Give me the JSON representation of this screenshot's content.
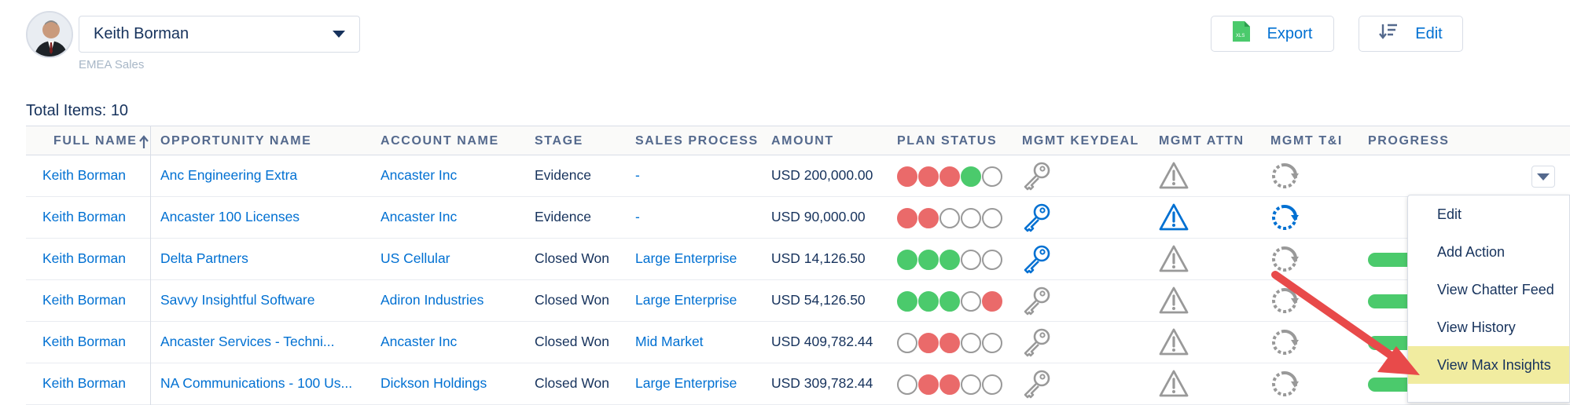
{
  "header": {
    "user_name": "Keith Borman",
    "user_subtitle": "EMEA Sales",
    "export_label": "Export",
    "edit_label": "Edit",
    "export_icon_text": "XLS"
  },
  "total_items": "Total Items: 10",
  "columns": [
    "FULL NAME",
    "OPPORTUNITY NAME",
    "ACCOUNT NAME",
    "STAGE",
    "SALES PROCESS",
    "AMOUNT",
    "PLAN STATUS",
    "MGMT KEYDEAL",
    "MGMT ATTN",
    "MGMT T&I",
    "PROGRESS"
  ],
  "rows": [
    {
      "full_name": "Keith Borman",
      "opportunity": "Anc Engineering Extra",
      "account": "Ancaster Inc",
      "stage": "Evidence",
      "sales_process": "-",
      "amount": "USD 200,000.00",
      "plan_status": [
        "red",
        "red",
        "red",
        "green",
        "empty"
      ],
      "keydeal_active": false,
      "attn_active": false,
      "ti_active": false,
      "progress": false
    },
    {
      "full_name": "Keith Borman",
      "opportunity": "Ancaster 100 Licenses",
      "account": "Ancaster Inc",
      "stage": "Evidence",
      "sales_process": "-",
      "amount": "USD 90,000.00",
      "plan_status": [
        "red",
        "red",
        "empty",
        "empty",
        "empty"
      ],
      "keydeal_active": true,
      "attn_active": true,
      "ti_active": true,
      "progress": false
    },
    {
      "full_name": "Keith Borman",
      "opportunity": "Delta Partners",
      "account": "US Cellular",
      "stage": "Closed Won",
      "sales_process": "Large Enterprise",
      "amount": "USD 14,126.50",
      "plan_status": [
        "green",
        "green",
        "green",
        "empty",
        "empty"
      ],
      "keydeal_active": true,
      "attn_active": false,
      "ti_active": false,
      "progress": true
    },
    {
      "full_name": "Keith Borman",
      "opportunity": "Savvy Insightful Software",
      "account": "Adiron Industries",
      "stage": "Closed Won",
      "sales_process": "Large Enterprise",
      "amount": "USD 54,126.50",
      "plan_status": [
        "green",
        "green",
        "green",
        "empty",
        "red"
      ],
      "keydeal_active": false,
      "attn_active": false,
      "ti_active": false,
      "progress": true
    },
    {
      "full_name": "Keith Borman",
      "opportunity": "Ancaster Services - Techni...",
      "account": "Ancaster Inc",
      "stage": "Closed Won",
      "sales_process": "Mid Market",
      "amount": "USD 409,782.44",
      "plan_status": [
        "empty",
        "red",
        "red",
        "empty",
        "empty"
      ],
      "keydeal_active": false,
      "attn_active": false,
      "ti_active": false,
      "progress": true
    },
    {
      "full_name": "Keith Borman",
      "opportunity": "NA Communications - 100 Us...",
      "account": "Dickson Holdings",
      "stage": "Closed Won",
      "sales_process": "Large Enterprise",
      "amount": "USD 309,782.44",
      "plan_status": [
        "empty",
        "red",
        "red",
        "empty",
        "empty"
      ],
      "keydeal_active": false,
      "attn_active": false,
      "ti_active": false,
      "progress": true
    }
  ],
  "row_menu": {
    "items": [
      "Edit",
      "Add Action",
      "View Chatter Feed",
      "View History",
      "View Max Insights"
    ],
    "highlighted": "View Max Insights"
  },
  "icons": {
    "keydeal": "key-icon",
    "attn": "warning-icon",
    "ti": "refresh-icon",
    "sort": "arrow-up-icon"
  },
  "colors": {
    "link": "#0070d2",
    "red": "#ea6a6a",
    "green": "#4bca6c",
    "inactive_icon": "#999999",
    "highlight": "#f1eca0",
    "annotation_arrow": "#e84a4a"
  }
}
